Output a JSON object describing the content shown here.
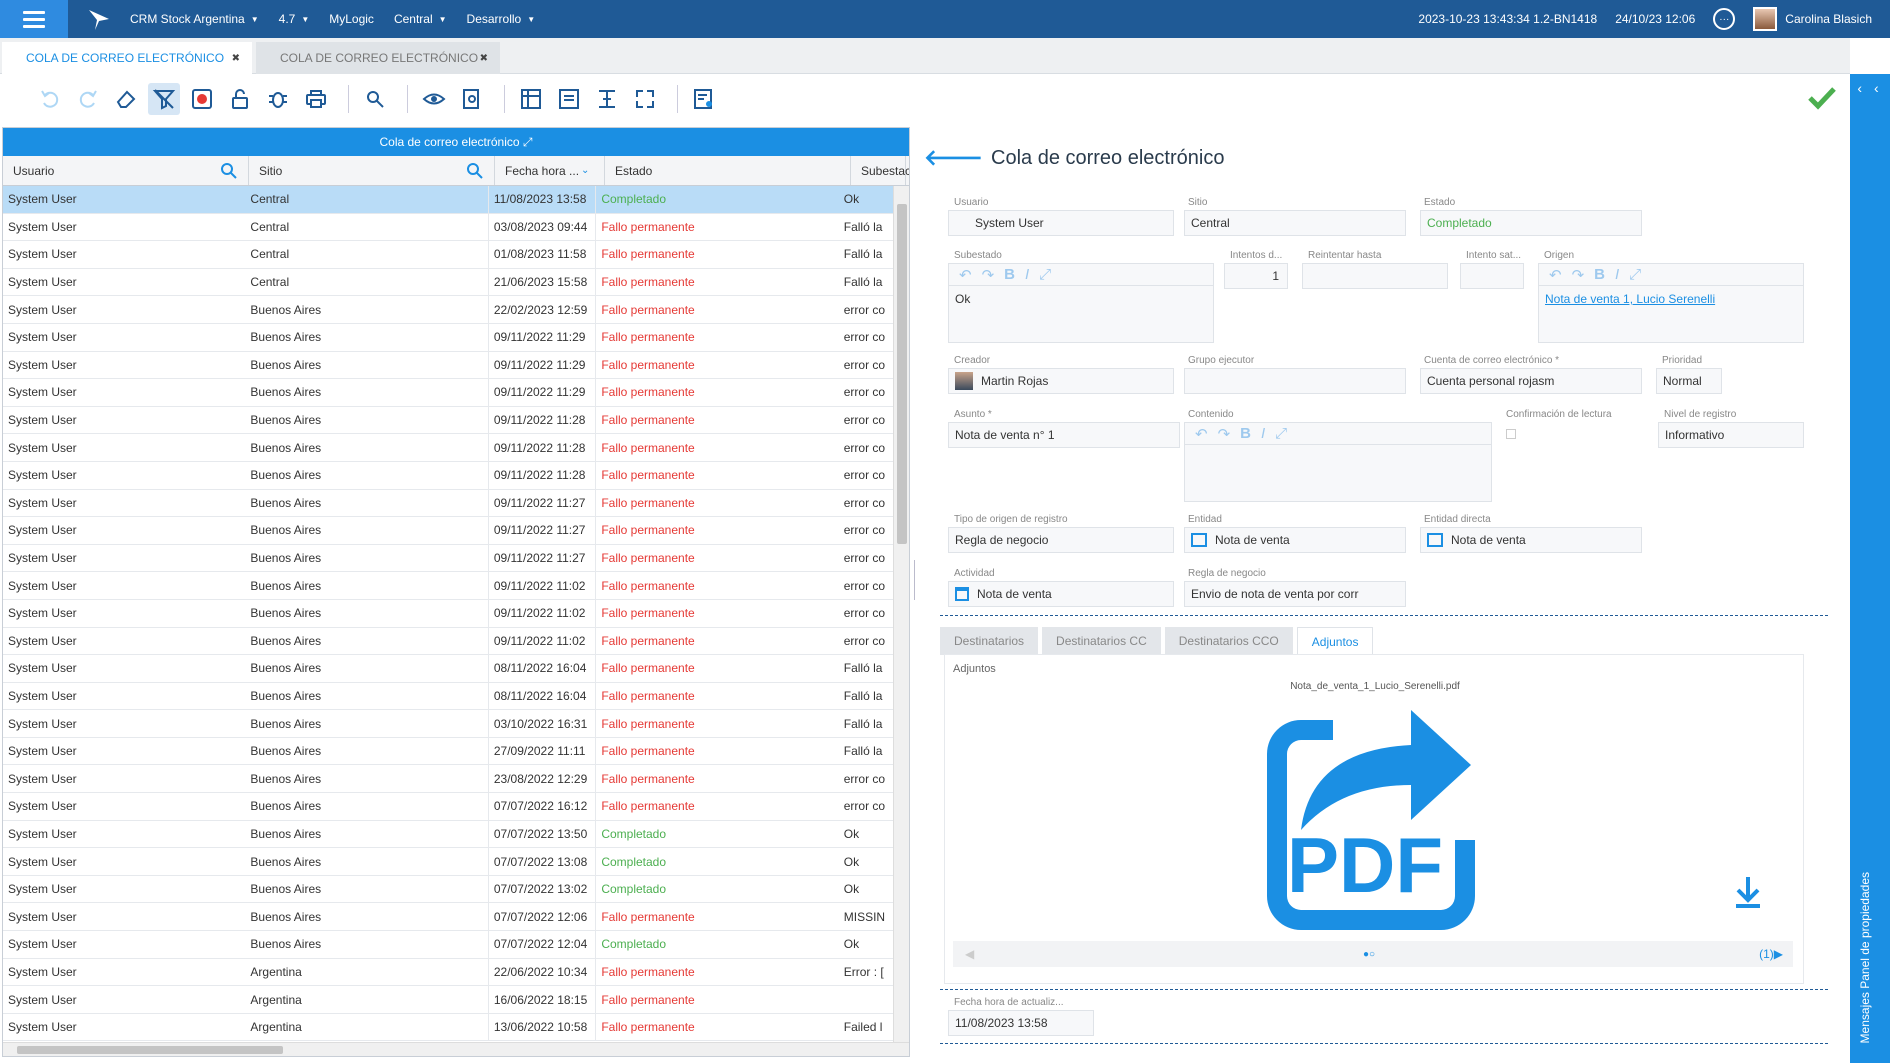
{
  "topbar": {
    "app_name": "CRM Stock Argentina",
    "version": "4.7",
    "user_menu": "MyLogic",
    "site": "Central",
    "env": "Desarrollo",
    "build": "2023-10-23 13:43:34 1.2-BN1418",
    "date": "24/10/23 12:06",
    "username": "Carolina Blasich"
  },
  "tabs": [
    {
      "label": "COLA DE CORREO ELECTRÓNICO",
      "active": true
    },
    {
      "label": "COLA DE CORREO ELECTRÓNICO",
      "active": false
    }
  ],
  "grid": {
    "title": "Cola de correo electrónico",
    "columns": [
      "Usuario",
      "Sitio",
      "Fecha hora ...",
      "Estado",
      "Subestac"
    ],
    "rows": [
      [
        "System User",
        "Central",
        "11/08/2023 13:58",
        "Completado",
        "Ok"
      ],
      [
        "System User",
        "Central",
        "03/08/2023 09:44",
        "Fallo permanente",
        "Falló la"
      ],
      [
        "System User",
        "Central",
        "01/08/2023 11:58",
        "Fallo permanente",
        "Falló la"
      ],
      [
        "System User",
        "Central",
        "21/06/2023 15:58",
        "Fallo permanente",
        "Falló la"
      ],
      [
        "System User",
        "Buenos Aires",
        "22/02/2023 12:59",
        "Fallo permanente",
        "error co"
      ],
      [
        "System User",
        "Buenos Aires",
        "09/11/2022 11:29",
        "Fallo permanente",
        "error co"
      ],
      [
        "System User",
        "Buenos Aires",
        "09/11/2022 11:29",
        "Fallo permanente",
        "error co"
      ],
      [
        "System User",
        "Buenos Aires",
        "09/11/2022 11:29",
        "Fallo permanente",
        "error co"
      ],
      [
        "System User",
        "Buenos Aires",
        "09/11/2022 11:28",
        "Fallo permanente",
        "error co"
      ],
      [
        "System User",
        "Buenos Aires",
        "09/11/2022 11:28",
        "Fallo permanente",
        "error co"
      ],
      [
        "System User",
        "Buenos Aires",
        "09/11/2022 11:28",
        "Fallo permanente",
        "error co"
      ],
      [
        "System User",
        "Buenos Aires",
        "09/11/2022 11:27",
        "Fallo permanente",
        "error co"
      ],
      [
        "System User",
        "Buenos Aires",
        "09/11/2022 11:27",
        "Fallo permanente",
        "error co"
      ],
      [
        "System User",
        "Buenos Aires",
        "09/11/2022 11:27",
        "Fallo permanente",
        "error co"
      ],
      [
        "System User",
        "Buenos Aires",
        "09/11/2022 11:02",
        "Fallo permanente",
        "error co"
      ],
      [
        "System User",
        "Buenos Aires",
        "09/11/2022 11:02",
        "Fallo permanente",
        "error co"
      ],
      [
        "System User",
        "Buenos Aires",
        "09/11/2022 11:02",
        "Fallo permanente",
        "error co"
      ],
      [
        "System User",
        "Buenos Aires",
        "08/11/2022 16:04",
        "Fallo permanente",
        "Falló la"
      ],
      [
        "System User",
        "Buenos Aires",
        "08/11/2022 16:04",
        "Fallo permanente",
        "Falló la"
      ],
      [
        "System User",
        "Buenos Aires",
        "03/10/2022 16:31",
        "Fallo permanente",
        "Falló la"
      ],
      [
        "System User",
        "Buenos Aires",
        "27/09/2022 11:11",
        "Fallo permanente",
        "Falló la"
      ],
      [
        "System User",
        "Buenos Aires",
        "23/08/2022 12:29",
        "Fallo permanente",
        "error co"
      ],
      [
        "System User",
        "Buenos Aires",
        "07/07/2022 16:12",
        "Fallo permanente",
        "error co"
      ],
      [
        "System User",
        "Buenos Aires",
        "07/07/2022 13:50",
        "Completado",
        "Ok"
      ],
      [
        "System User",
        "Buenos Aires",
        "07/07/2022 13:08",
        "Completado",
        "Ok"
      ],
      [
        "System User",
        "Buenos Aires",
        "07/07/2022 13:02",
        "Completado",
        "Ok"
      ],
      [
        "System User",
        "Buenos Aires",
        "07/07/2022 12:06",
        "Fallo permanente",
        "MISSIN"
      ],
      [
        "System User",
        "Buenos Aires",
        "07/07/2022 12:04",
        "Completado",
        "Ok"
      ],
      [
        "System User",
        "Argentina",
        "22/06/2022 10:34",
        "Fallo permanente",
        "Error : ["
      ],
      [
        "System User",
        "Argentina",
        "16/06/2022 18:15",
        "Fallo permanente",
        ""
      ],
      [
        "System User",
        "Argentina",
        "13/06/2022 10:58",
        "Fallo permanente",
        "Failed l"
      ]
    ]
  },
  "detail": {
    "title": "Cola de correo electrónico",
    "labels": {
      "usuario": "Usuario",
      "sitio": "Sitio",
      "estado": "Estado",
      "subestado": "Subestado",
      "intentos": "Intentos d...",
      "reintentar": "Reintentar hasta",
      "intento_sat": "Intento sat...",
      "origen": "Origen",
      "creador": "Creador",
      "grupo": "Grupo ejecutor",
      "cuenta": "Cuenta de correo electrónico *",
      "prioridad": "Prioridad",
      "asunto": "Asunto *",
      "contenido": "Contenido",
      "confirmacion": "Confirmación de lectura",
      "nivel": "Nivel de registro",
      "tipo_origen": "Tipo de origen de registro",
      "entidad": "Entidad",
      "entidad_directa": "Entidad directa",
      "actividad": "Actividad",
      "regla": "Regla de negocio",
      "fecha_act": "Fecha hora de actualiz..."
    },
    "values": {
      "usuario": "System User",
      "sitio": "Central",
      "estado": "Completado",
      "subestado": "Ok",
      "intentos": "1",
      "reintentar": "",
      "intento_sat": "",
      "origen": "Nota de venta 1, Lucio Serenelli",
      "creador": "Martin Rojas",
      "grupo": "",
      "cuenta": "Cuenta personal rojasm",
      "prioridad": "Normal",
      "asunto": "Nota de venta n° 1",
      "nivel": "Informativo",
      "tipo_origen": "Regla de negocio",
      "entidad": "Nota de venta",
      "entidad_directa": "Nota de venta",
      "actividad": "Nota de venta",
      "regla": "Envio de nota de venta por corr",
      "fecha_act": "11/08/2023 13:58"
    },
    "tabs": [
      "Destinatarios",
      "Destinatarios CC",
      "Destinatarios CCO",
      "Adjuntos"
    ],
    "attach_label": "Adjuntos",
    "attach_file": "Nota_de_venta_1_Lucio_Serenelli.pdf",
    "pdf_text": "PDF",
    "pager_count": "(1)",
    "rte_bold": "B",
    "rte_italic": "I"
  },
  "rail": {
    "arrows": "‹ ‹",
    "text": "Mensajes   Panel de propiedades"
  },
  "colors": {
    "brand": "#1f5a96",
    "accent": "#1b8fe3",
    "ok": "#4caf50",
    "fail": "#e53935"
  }
}
